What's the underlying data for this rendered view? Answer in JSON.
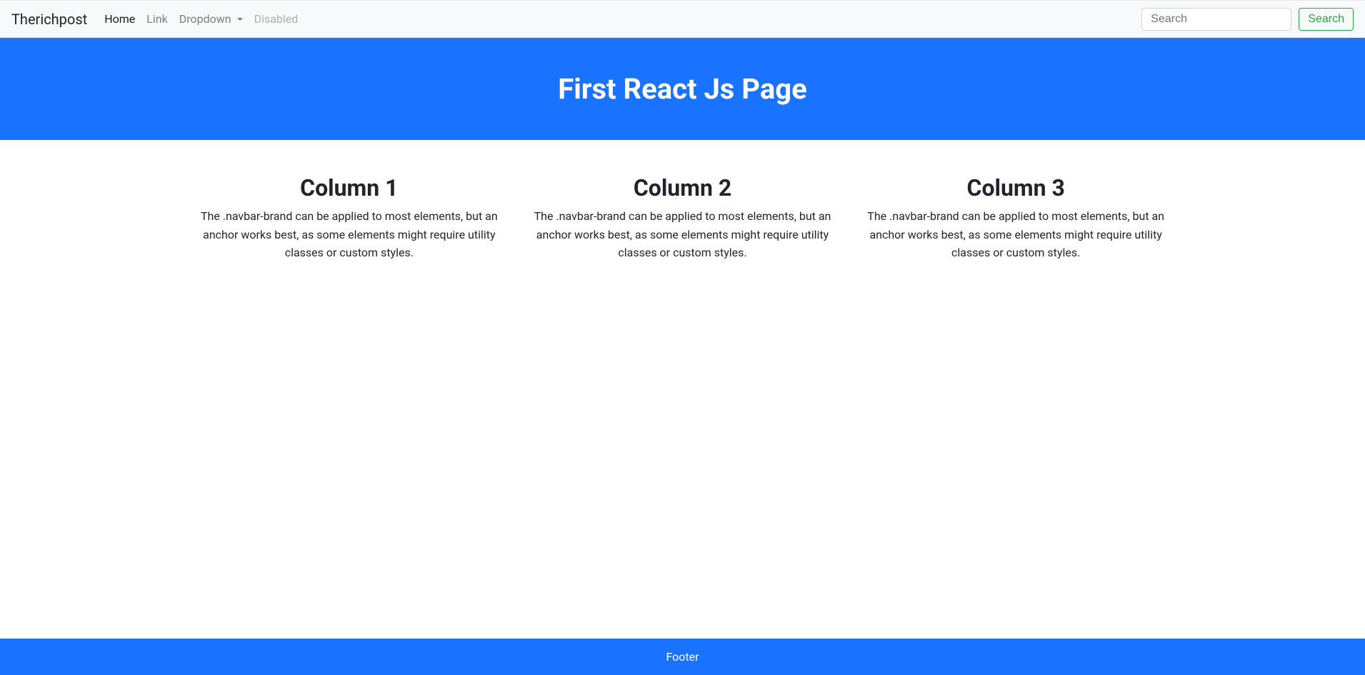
{
  "navbar": {
    "brand": "Therichpost",
    "items": [
      {
        "label": "Home",
        "active": true
      },
      {
        "label": "Link",
        "active": false
      },
      {
        "label": "Dropdown",
        "active": false,
        "dropdown": true
      },
      {
        "label": "Disabled",
        "disabled": true
      }
    ],
    "search": {
      "placeholder": "Search",
      "button_label": "Search"
    }
  },
  "jumbotron": {
    "title": "First React Js Page"
  },
  "columns": [
    {
      "title": "Column 1",
      "text": "The .navbar-brand can be applied to most elements, but an anchor works best, as some elements might require utility classes or custom styles."
    },
    {
      "title": "Column 2",
      "text": "The .navbar-brand can be applied to most elements, but an anchor works best, as some elements might require utility classes or custom styles."
    },
    {
      "title": "Column 3",
      "text": "The .navbar-brand can be applied to most elements, but an anchor works best, as some elements might require utility classes or custom styles."
    }
  ],
  "footer": {
    "text": "Footer"
  }
}
